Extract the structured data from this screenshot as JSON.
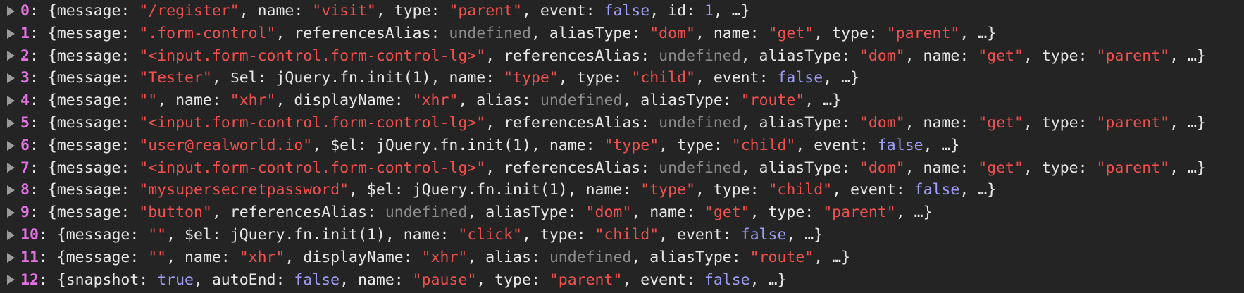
{
  "colors": {
    "background": "#242424",
    "index": "#e372e3",
    "key": "#e8e8e8",
    "string": "#f0514f",
    "boolean": "#9e9ef7",
    "number": "#9e9ef7",
    "undefined": "#8c8c8c",
    "expand_arrow": "#9a9a9a"
  },
  "icons": {
    "expand": "disclosure-triangle-right-icon"
  },
  "rows": [
    {
      "index": "0",
      "props": [
        {
          "key": "message",
          "value": "\"/register\"",
          "type": "str"
        },
        {
          "key": "name",
          "value": "\"visit\"",
          "type": "str"
        },
        {
          "key": "type",
          "value": "\"parent\"",
          "type": "str"
        },
        {
          "key": "event",
          "value": "false",
          "type": "bool"
        },
        {
          "key": "id",
          "value": "1",
          "type": "num"
        }
      ]
    },
    {
      "index": "1",
      "props": [
        {
          "key": "message",
          "value": "\".form-control\"",
          "type": "str"
        },
        {
          "key": "referencesAlias",
          "value": "undefined",
          "type": "undef"
        },
        {
          "key": "aliasType",
          "value": "\"dom\"",
          "type": "str"
        },
        {
          "key": "name",
          "value": "\"get\"",
          "type": "str"
        },
        {
          "key": "type",
          "value": "\"parent\"",
          "type": "str"
        }
      ]
    },
    {
      "index": "2",
      "props": [
        {
          "key": "message",
          "value": "\"<input.form-control.form-control-lg>\"",
          "type": "str"
        },
        {
          "key": "referencesAlias",
          "value": "undefined",
          "type": "undef"
        },
        {
          "key": "aliasType",
          "value": "\"dom\"",
          "type": "str"
        },
        {
          "key": "name",
          "value": "\"get\"",
          "type": "str"
        },
        {
          "key": "type",
          "value": "\"parent\"",
          "type": "str"
        }
      ]
    },
    {
      "index": "3",
      "props": [
        {
          "key": "message",
          "value": "\"Tester\"",
          "type": "str"
        },
        {
          "key": "$el",
          "value": "jQuery.fn.init(1)",
          "type": "obj"
        },
        {
          "key": "name",
          "value": "\"type\"",
          "type": "str"
        },
        {
          "key": "type",
          "value": "\"child\"",
          "type": "str"
        },
        {
          "key": "event",
          "value": "false",
          "type": "bool"
        }
      ]
    },
    {
      "index": "4",
      "props": [
        {
          "key": "message",
          "value": "\"\"",
          "type": "str"
        },
        {
          "key": "name",
          "value": "\"xhr\"",
          "type": "str"
        },
        {
          "key": "displayName",
          "value": "\"xhr\"",
          "type": "str"
        },
        {
          "key": "alias",
          "value": "undefined",
          "type": "undef"
        },
        {
          "key": "aliasType",
          "value": "\"route\"",
          "type": "str"
        }
      ]
    },
    {
      "index": "5",
      "props": [
        {
          "key": "message",
          "value": "\"<input.form-control.form-control-lg>\"",
          "type": "str"
        },
        {
          "key": "referencesAlias",
          "value": "undefined",
          "type": "undef"
        },
        {
          "key": "aliasType",
          "value": "\"dom\"",
          "type": "str"
        },
        {
          "key": "name",
          "value": "\"get\"",
          "type": "str"
        },
        {
          "key": "type",
          "value": "\"parent\"",
          "type": "str"
        }
      ]
    },
    {
      "index": "6",
      "props": [
        {
          "key": "message",
          "value": "\"user@realworld.io\"",
          "type": "str"
        },
        {
          "key": "$el",
          "value": "jQuery.fn.init(1)",
          "type": "obj"
        },
        {
          "key": "name",
          "value": "\"type\"",
          "type": "str"
        },
        {
          "key": "type",
          "value": "\"child\"",
          "type": "str"
        },
        {
          "key": "event",
          "value": "false",
          "type": "bool"
        }
      ]
    },
    {
      "index": "7",
      "props": [
        {
          "key": "message",
          "value": "\"<input.form-control.form-control-lg>\"",
          "type": "str"
        },
        {
          "key": "referencesAlias",
          "value": "undefined",
          "type": "undef"
        },
        {
          "key": "aliasType",
          "value": "\"dom\"",
          "type": "str"
        },
        {
          "key": "name",
          "value": "\"get\"",
          "type": "str"
        },
        {
          "key": "type",
          "value": "\"parent\"",
          "type": "str"
        }
      ]
    },
    {
      "index": "8",
      "props": [
        {
          "key": "message",
          "value": "\"mysupersecretpassword\"",
          "type": "str"
        },
        {
          "key": "$el",
          "value": "jQuery.fn.init(1)",
          "type": "obj"
        },
        {
          "key": "name",
          "value": "\"type\"",
          "type": "str"
        },
        {
          "key": "type",
          "value": "\"child\"",
          "type": "str"
        },
        {
          "key": "event",
          "value": "false",
          "type": "bool"
        }
      ]
    },
    {
      "index": "9",
      "props": [
        {
          "key": "message",
          "value": "\"button\"",
          "type": "str"
        },
        {
          "key": "referencesAlias",
          "value": "undefined",
          "type": "undef"
        },
        {
          "key": "aliasType",
          "value": "\"dom\"",
          "type": "str"
        },
        {
          "key": "name",
          "value": "\"get\"",
          "type": "str"
        },
        {
          "key": "type",
          "value": "\"parent\"",
          "type": "str"
        }
      ]
    },
    {
      "index": "10",
      "props": [
        {
          "key": "message",
          "value": "\"\"",
          "type": "str"
        },
        {
          "key": "$el",
          "value": "jQuery.fn.init(1)",
          "type": "obj"
        },
        {
          "key": "name",
          "value": "\"click\"",
          "type": "str"
        },
        {
          "key": "type",
          "value": "\"child\"",
          "type": "str"
        },
        {
          "key": "event",
          "value": "false",
          "type": "bool"
        }
      ]
    },
    {
      "index": "11",
      "props": [
        {
          "key": "message",
          "value": "\"\"",
          "type": "str"
        },
        {
          "key": "name",
          "value": "\"xhr\"",
          "type": "str"
        },
        {
          "key": "displayName",
          "value": "\"xhr\"",
          "type": "str"
        },
        {
          "key": "alias",
          "value": "undefined",
          "type": "undef"
        },
        {
          "key": "aliasType",
          "value": "\"route\"",
          "type": "str"
        }
      ]
    },
    {
      "index": "12",
      "props": [
        {
          "key": "snapshot",
          "value": "true",
          "type": "bool"
        },
        {
          "key": "autoEnd",
          "value": "false",
          "type": "bool"
        },
        {
          "key": "name",
          "value": "\"pause\"",
          "type": "str"
        },
        {
          "key": "type",
          "value": "\"parent\"",
          "type": "str"
        },
        {
          "key": "event",
          "value": "false",
          "type": "bool"
        }
      ]
    }
  ]
}
